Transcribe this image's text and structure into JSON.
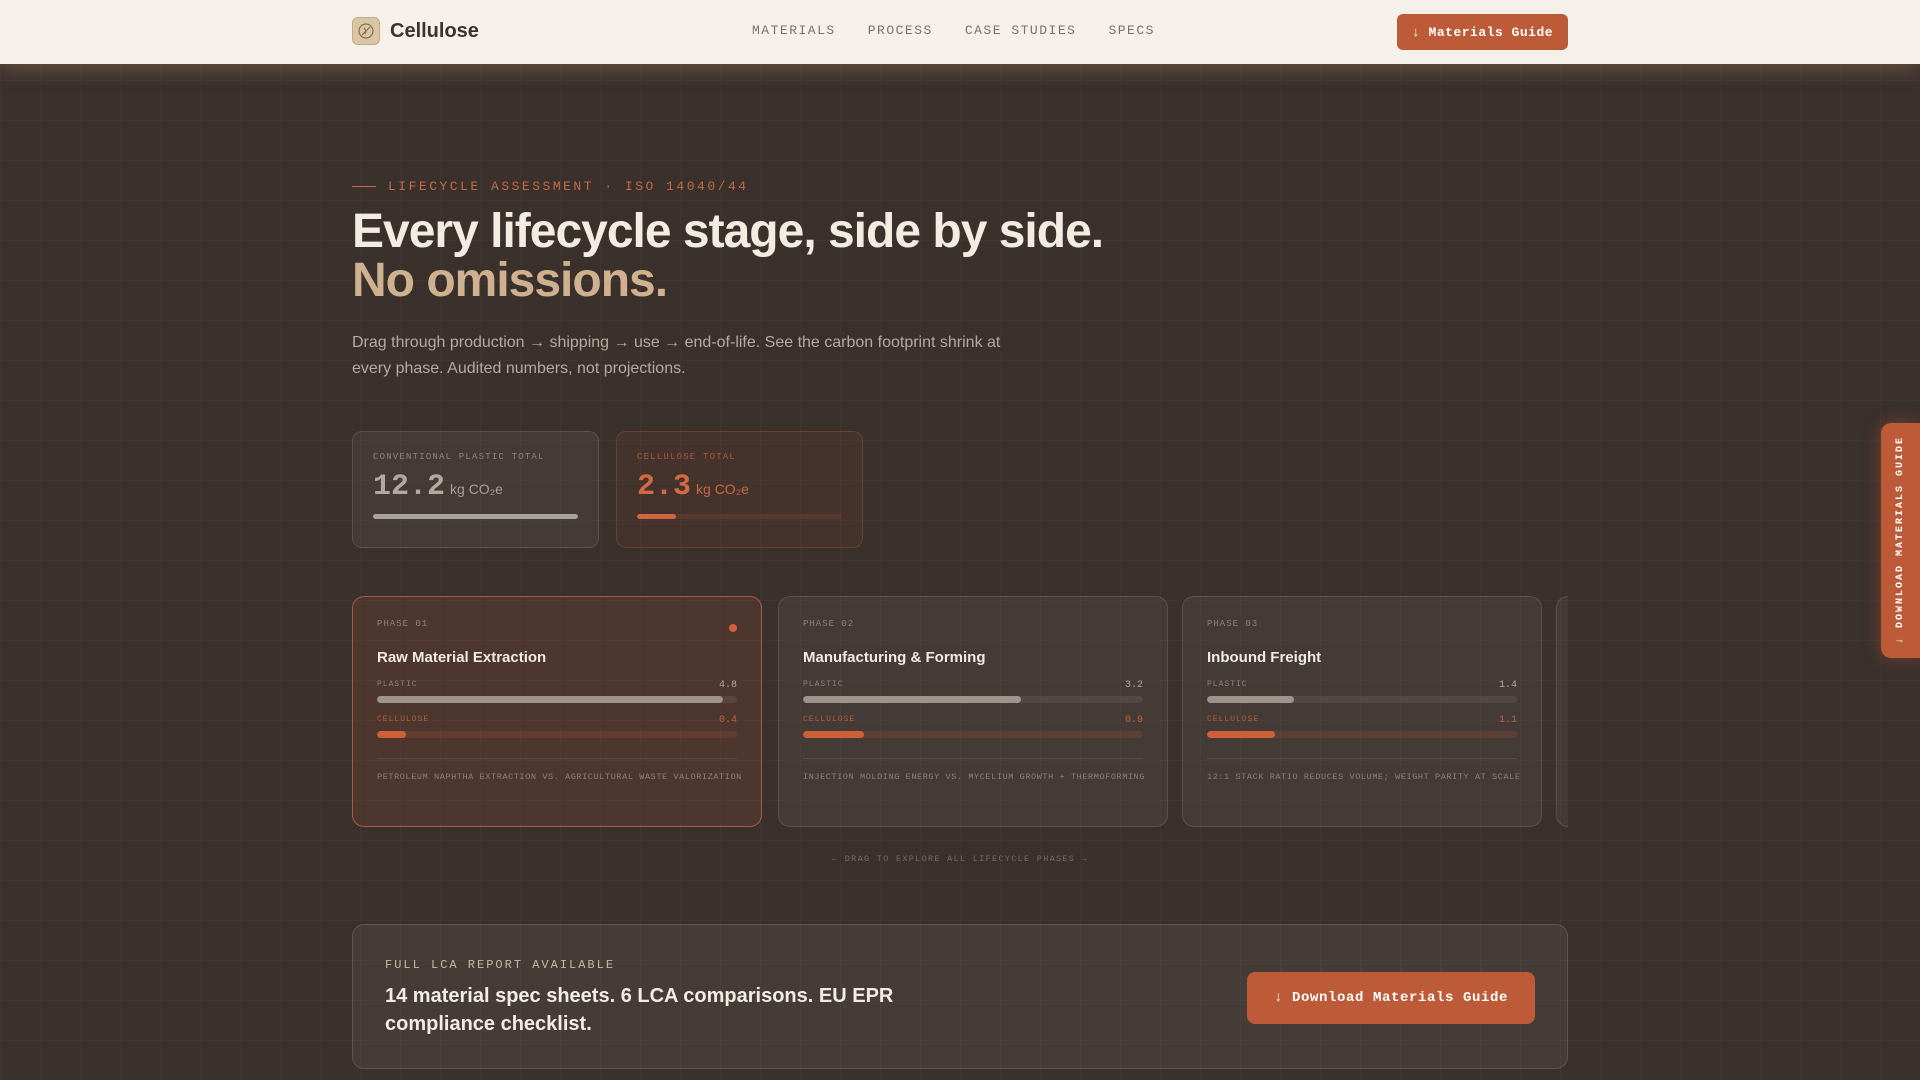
{
  "nav": {
    "brand": "Cellulose",
    "links": [
      "MATERIALS",
      "PROCESS",
      "CASE STUDIES",
      "SPECS"
    ],
    "cta_label": "↓ Materials Guide"
  },
  "hero": {
    "eyebrow": "LIFECYCLE ASSESSMENT · ISO 14040/44",
    "title": "Every lifecycle stage, side by side.",
    "title_accent": "No omissions.",
    "lead": "Drag through production → shipping → use → end-of-life. See the carbon footprint shrink at every phase. Audited numbers, not projections."
  },
  "totals": {
    "plastic": {
      "label": "CONVENTIONAL PLASTIC TOTAL",
      "value": "12.2",
      "unit": "kg CO₂e",
      "fill": 1.0
    },
    "cellulose": {
      "label": "CELLULOSE TOTAL",
      "value": "2.3",
      "unit": "kg CO₂e",
      "fill": 0.19
    }
  },
  "phases": [
    {
      "num": "PHASE 01",
      "title": "Raw Material Extraction",
      "active": true,
      "plastic_label": "PLASTIC",
      "plastic_value": "4.8",
      "plastic_fill": 0.96,
      "cellulose_label": "CELLULOSE",
      "cellulose_value": "0.4",
      "cellulose_fill": 0.08,
      "note": "PETROLEUM NAPHTHA EXTRACTION VS. AGRICULTURAL WASTE VALORIZATION"
    },
    {
      "num": "PHASE 02",
      "title": "Manufacturing & Forming",
      "active": false,
      "plastic_label": "PLASTIC",
      "plastic_value": "3.2",
      "plastic_fill": 0.64,
      "cellulose_label": "CELLULOSE",
      "cellulose_value": "0.9",
      "cellulose_fill": 0.18,
      "note": "INJECTION MOLDING ENERGY VS. MYCELIUM GROWTH + THERMOFORMING"
    },
    {
      "num": "PHASE 03",
      "title": "Inbound Freight",
      "active": false,
      "plastic_label": "PLASTIC",
      "plastic_value": "1.4",
      "plastic_fill": 0.28,
      "cellulose_label": "CELLULOSE",
      "cellulose_value": "1.1",
      "cellulose_fill": 0.22,
      "note": "12:1 STACK RATIO REDUCES VOLUME; WEIGHT PARITY AT SCALE"
    }
  ],
  "drag_hint": "← DRAG TO EXPLORE ALL LIFECYCLE PHASES →",
  "cta": {
    "eyebrow": "FULL LCA REPORT AVAILABLE",
    "headline": "14 material spec sheets. 6 LCA comparisons. EU EPR compliance checklist.",
    "button_label": "↓ Download Materials Guide"
  },
  "side_tab": {
    "label": "↓ DOWNLOAD MATERIALS GUIDE"
  },
  "colors": {
    "accent": "#bd5a37",
    "nav_bg": "#f5f1ea",
    "page_bg": "#3a302c"
  }
}
